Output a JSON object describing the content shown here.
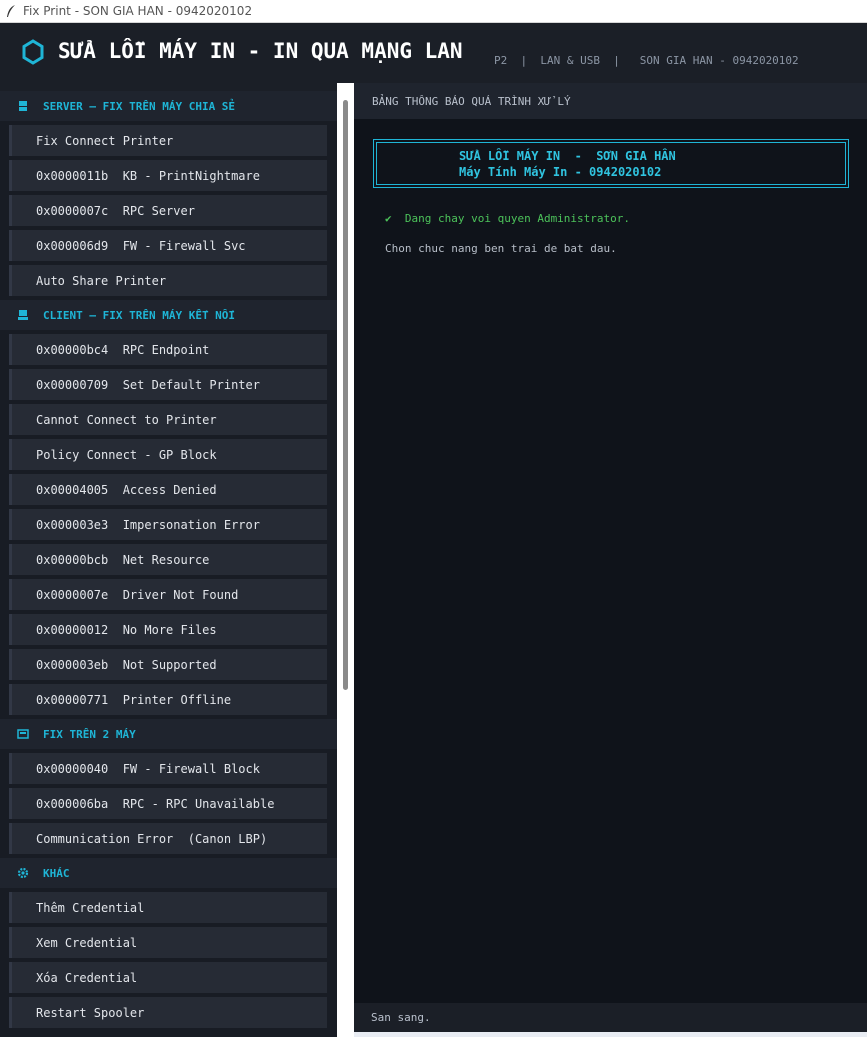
{
  "window": {
    "title": "Fix Print - SON GIA HAN - 0942020102"
  },
  "header": {
    "title": "SỬA LỖI MÁY IN - IN QUA MẠNG LAN",
    "meta": [
      "P2",
      "  |  ",
      "LAN & USB",
      "  |   ",
      "SON GIA HAN - 0942020102"
    ]
  },
  "sidebar": {
    "sections": [
      {
        "title": "SERVER – FIX TRÊN MÁY CHIA SẺ",
        "icon": "server-icon",
        "items": [
          "Fix Connect Printer",
          "0x0000011b  KB - PrintNightmare",
          "0x0000007c  RPC Server",
          "0x000006d9  FW - Firewall Svc",
          "Auto Share Printer"
        ]
      },
      {
        "title": "CLIENT – FIX TRÊN MÁY KẾT NỐI",
        "icon": "client-icon",
        "items": [
          "0x00000bc4  RPC Endpoint",
          "0x00000709  Set Default Printer",
          "Cannot Connect to Printer",
          "Policy Connect - GP Block",
          "0x00004005  Access Denied",
          "0x000003e3  Impersonation Error",
          "0x00000bcb  Net Resource",
          "0x0000007e  Driver Not Found",
          "0x00000012  No More Files",
          "0x000003eb  Not Supported",
          "0x00000771  Printer Offline"
        ]
      },
      {
        "title": "FIX TRÊN 2 MÁY",
        "icon": "two-machines-icon",
        "items": [
          "0x00000040  FW - Firewall Block",
          "0x000006ba  RPC - RPC Unavailable",
          "Communication Error  (Canon LBP)"
        ]
      },
      {
        "title": "KHÁC",
        "icon": "gear-icon",
        "items": [
          "Thêm Credential",
          "Xem Credential",
          "Xóa Credential",
          "Restart Spooler"
        ]
      }
    ]
  },
  "panel": {
    "title": "BẢNG THÔNG BÁO QUÁ TRÌNH XỬ LÝ",
    "banner_line1": "SỬA LỖI MÁY IN  -  SƠN GIA HÂN",
    "banner_line2": "Máy Tính Máy In - 0942020102",
    "log_ok": "✔  Dang chay voi quyen Administrator.",
    "log_info": "Chon chuc nang ben trai de bat dau.",
    "status": "San sang."
  },
  "colors": {
    "accent": "#1fb5d6",
    "success": "#4cc25a",
    "background": "#1b1f27"
  }
}
